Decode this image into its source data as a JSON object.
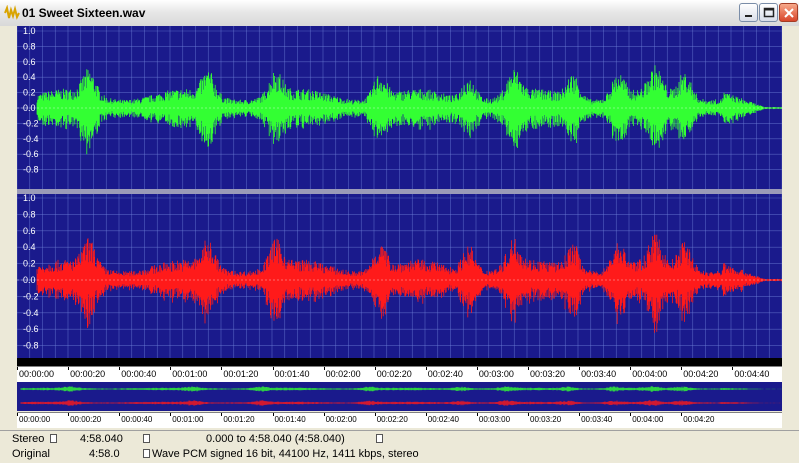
{
  "window": {
    "title": "01 Sweet Sixteen.wav",
    "icons": {
      "app": "audio-file-icon",
      "minimize": "minimize-icon",
      "maximize": "maximize-icon",
      "close": "close-icon"
    }
  },
  "waveform": {
    "channels": [
      {
        "color": "#33ff33",
        "amplitude_labels": [
          "1.0",
          "0.8",
          "0.6",
          "0.4",
          "0.2",
          "0.0",
          "-0.2",
          "-0.4",
          "-0.6",
          "-0.8"
        ]
      },
      {
        "color": "#ff1a1a",
        "amplitude_labels": [
          "1.0",
          "0.8",
          "0.6",
          "0.4",
          "0.2",
          "0.0",
          "-0.2",
          "-0.4",
          "-0.6",
          "-0.8"
        ]
      }
    ],
    "background_color": "#1a1a8c",
    "grid_color": "#6e80d8"
  },
  "timeline": {
    "labels": [
      "00:00:00",
      "00:00:20",
      "00:00:40",
      "00:01:00",
      "00:01:20",
      "00:01:40",
      "00:02:00",
      "00:02:20",
      "00:02:40",
      "00:03:00",
      "00:03:20",
      "00:03:40",
      "00:04:00",
      "00:04:20",
      "00:04:40"
    ]
  },
  "overview_timeline": {
    "labels": [
      "00:00:00",
      "00:00:20",
      "00:00:40",
      "00:01:00",
      "00:01:20",
      "00:01:40",
      "00:02:00",
      "00:02:20",
      "00:02:40",
      "00:03:00",
      "00:03:20",
      "00:03:40",
      "00:04:00",
      "00:04:20"
    ]
  },
  "status": {
    "row1": {
      "channels": "Stereo",
      "duration": "4:58.040",
      "selection": "0.000 to 4:58.040 (4:58.040)"
    },
    "row2": {
      "mode": "Original",
      "duration": "4:58.0",
      "format": "Wave PCM signed 16 bit, 44100 Hz, 1411 kbps, stereo"
    }
  }
}
